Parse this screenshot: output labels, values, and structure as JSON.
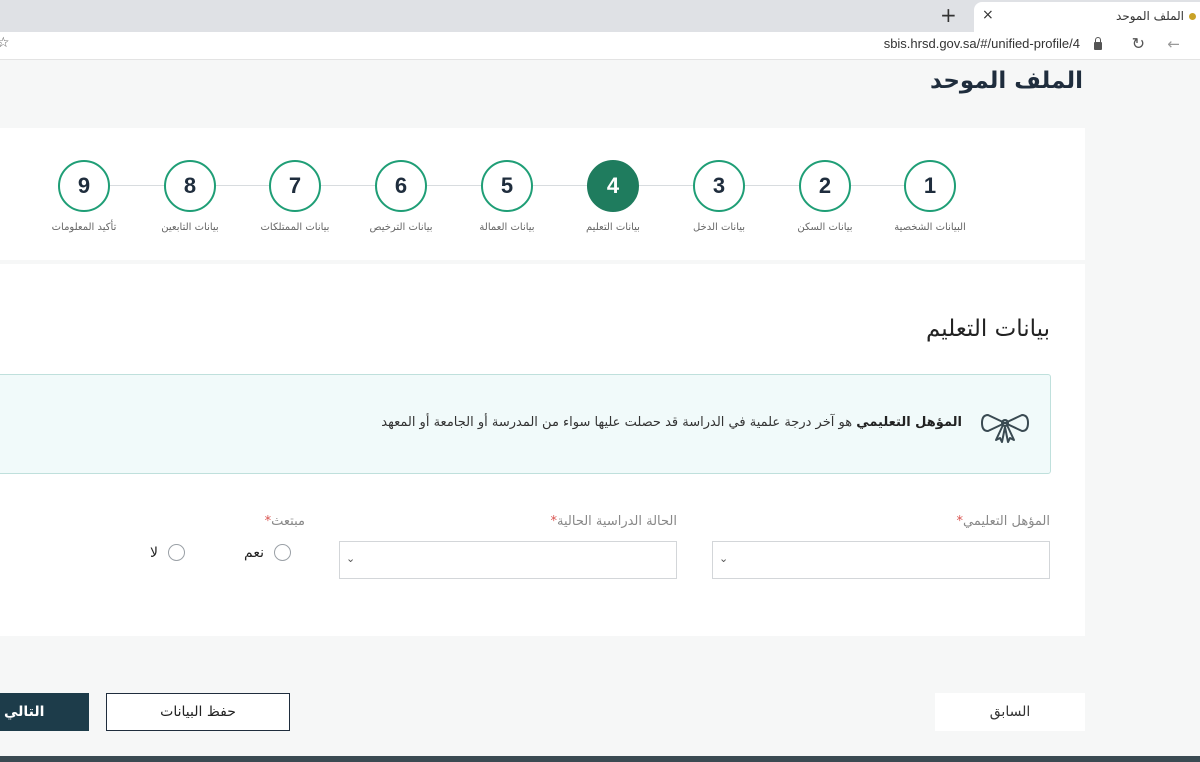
{
  "browser": {
    "tab_title": "الملف الموحد",
    "tab_close": "×",
    "new_tab": "+",
    "url": "sbis.hrsd.gov.sa/#/unified-profile/4"
  },
  "page": {
    "title": "الملف الموحد"
  },
  "steps": [
    {
      "number": "1",
      "label": "البيانات الشخصية",
      "active": false
    },
    {
      "number": "2",
      "label": "بيانات السكن",
      "active": false
    },
    {
      "number": "3",
      "label": "بيانات الدخل",
      "active": false
    },
    {
      "number": "4",
      "label": "بيانات التعليم",
      "active": true
    },
    {
      "number": "5",
      "label": "بيانات العمالة",
      "active": false
    },
    {
      "number": "6",
      "label": "بيانات الترخيص",
      "active": false
    },
    {
      "number": "7",
      "label": "بيانات الممتلكات",
      "active": false
    },
    {
      "number": "8",
      "label": "بيانات التابعين",
      "active": false
    },
    {
      "number": "9",
      "label": "تأكيد المعلومات",
      "active": false
    }
  ],
  "section": {
    "title": "بيانات التعليم",
    "info_bold": "المؤهل التعليمي",
    "info_text": " هو آخر درجة علمية في الدراسة قد حصلت عليها سواء من المدرسة أو الجامعة أو المعهد"
  },
  "fields": {
    "qualification": {
      "label": "المؤهل التعليمي",
      "required": "*",
      "value": ""
    },
    "study_status": {
      "label": "الحالة الدراسية الحالية",
      "required": "*",
      "value": ""
    },
    "scholarship": {
      "label": "مبتعث",
      "required": "*",
      "options": [
        "نعم",
        "لا"
      ]
    }
  },
  "buttons": {
    "previous": "السابق",
    "save": "حفظ البيانات",
    "next": "التالي"
  },
  "colors": {
    "accent": "#1f7c5e",
    "step_border": "#1f9e76",
    "primary_button": "#1d3c4a",
    "info_bg": "#f1fafa"
  }
}
